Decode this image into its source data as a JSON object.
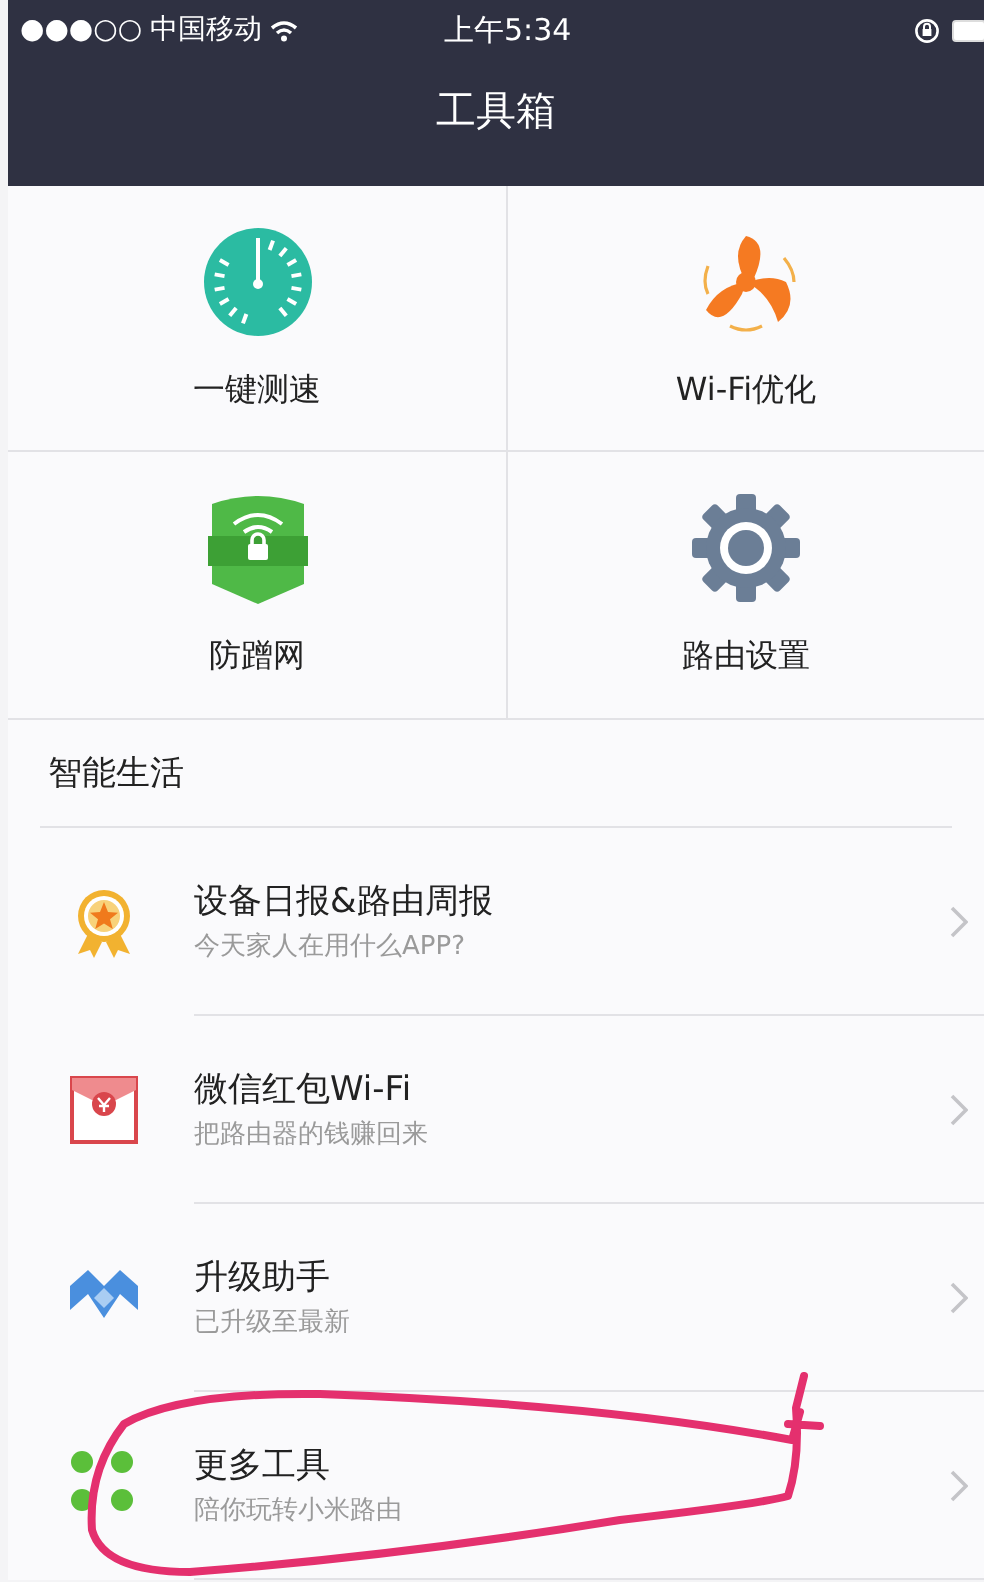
{
  "status_bar": {
    "signal": "●●●○○",
    "carrier": "中国移动",
    "time": "上午5:34"
  },
  "title": "工具箱",
  "tools": [
    {
      "label": "一键测速"
    },
    {
      "label": "Wi-Fi优化"
    },
    {
      "label": "防蹭网"
    },
    {
      "label": "路由设置"
    }
  ],
  "section": {
    "title": "智能生活"
  },
  "features": [
    {
      "title": "设备日报&路由周报",
      "subtitle": "今天家人在用什么APP?"
    },
    {
      "title": "微信红包Wi-Fi",
      "subtitle": "把路由器的钱赚回来"
    },
    {
      "title": "升级助手",
      "subtitle": "已升级至最新"
    },
    {
      "title": "更多工具",
      "subtitle": "陪你玩转小米路由"
    }
  ]
}
